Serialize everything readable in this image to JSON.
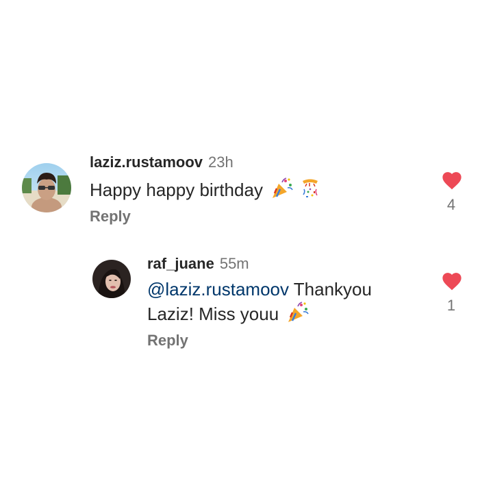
{
  "comments": [
    {
      "username": "laziz.rustamoov",
      "time": "23h",
      "text": "Happy happy birthday",
      "emojis": [
        "party-popper",
        "confetti-ball"
      ],
      "reply_label": "Reply",
      "likes": "4",
      "liked": true
    },
    {
      "username": "raf_juane",
      "time": "55m",
      "mention": "@laziz.rustamoov",
      "text_line1": "Thankyou",
      "text_line2": "Laziz! Miss youu",
      "emojis": [
        "party-popper"
      ],
      "reply_label": "Reply",
      "likes": "1",
      "liked": true
    }
  ],
  "colors": {
    "heart": "#ed4956",
    "mention": "#00376b",
    "secondary": "#737373"
  }
}
